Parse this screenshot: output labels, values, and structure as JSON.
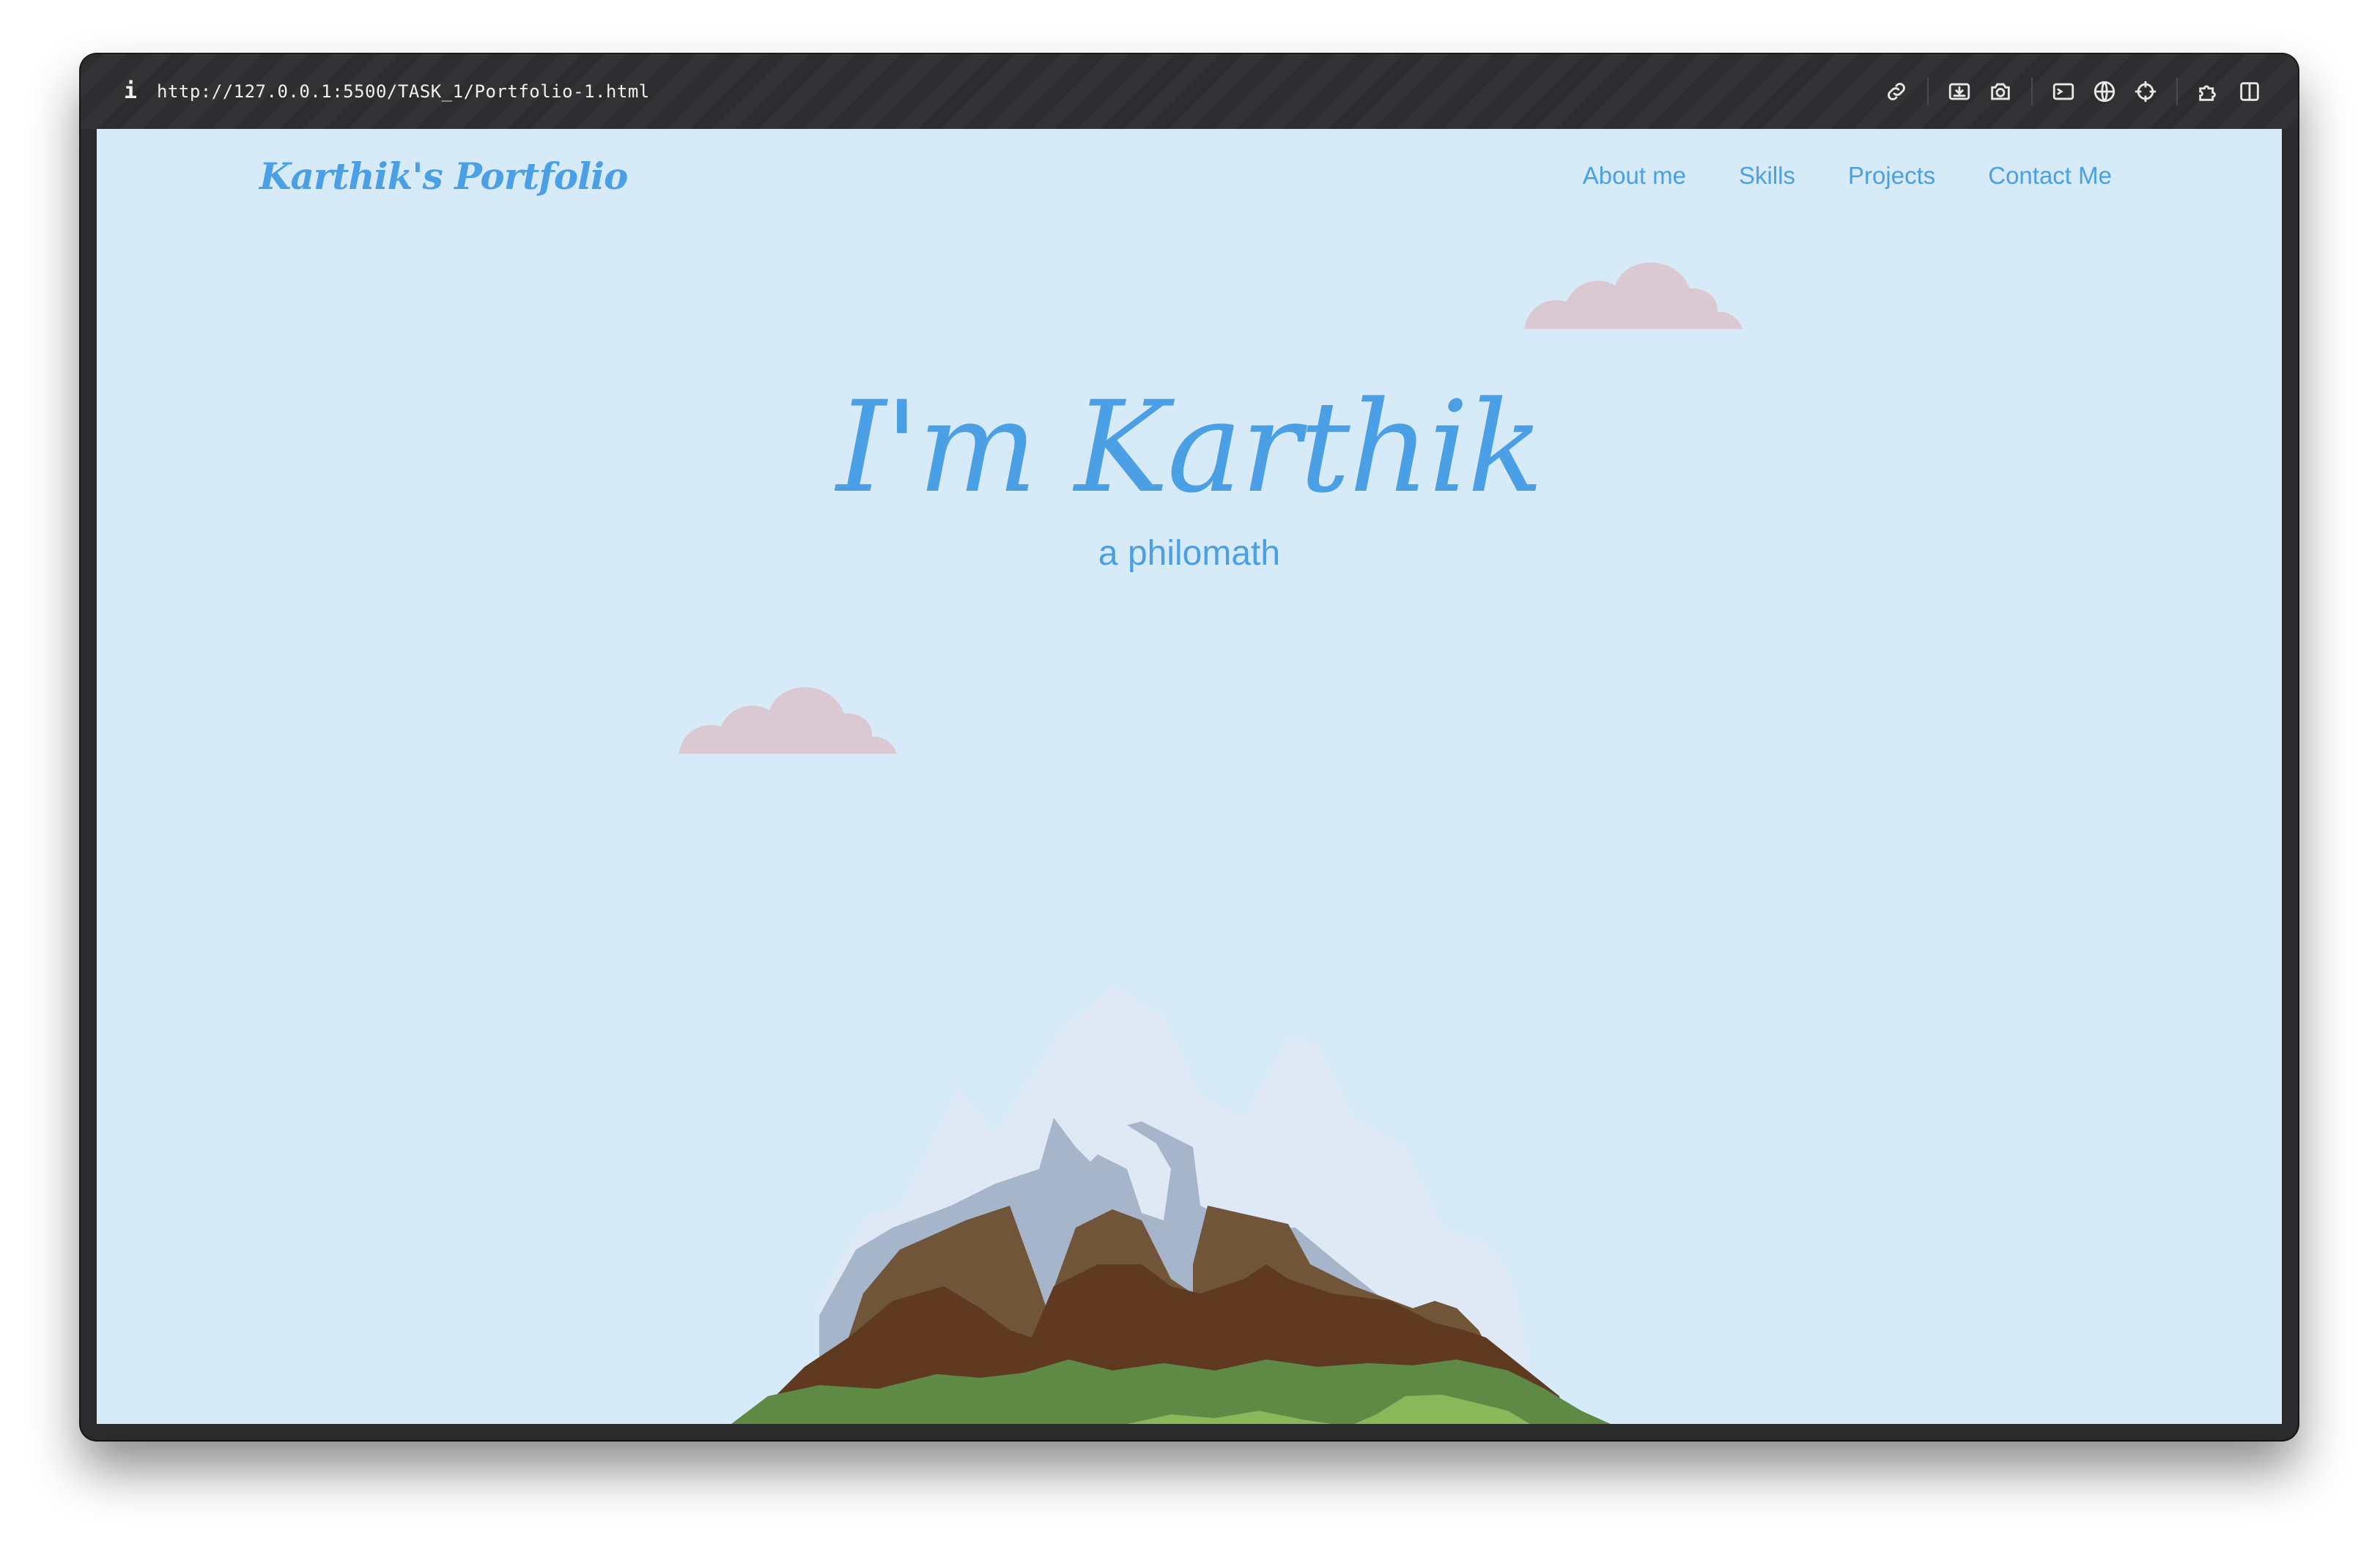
{
  "browser": {
    "url": "http://127.0.0.1:5500/TASK_1/Portfolio-1.html",
    "info_icon": "info-icon",
    "toolbar_icons": [
      "link-icon",
      "screenshot-icon",
      "camera-icon",
      "terminal-icon",
      "globe-icon",
      "crosshair-icon",
      "extensions-icon",
      "sidebar-icon"
    ]
  },
  "site": {
    "brand": "Karthik's Portfolio",
    "nav": [
      "About me",
      "Skills",
      "Projects",
      "Contact Me"
    ],
    "hero_title": "I'm Karthik",
    "hero_subtitle": "a philomath"
  },
  "colors": {
    "accent": "#4a9fe5",
    "background": "#d7eaf8",
    "cloud": "#dac9d3"
  }
}
